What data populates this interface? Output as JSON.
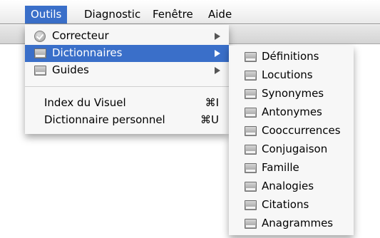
{
  "menubar": {
    "items": [
      "Outils",
      "Diagnostic",
      "Fenêtre",
      "Aide"
    ]
  },
  "outils_menu": {
    "items": [
      {
        "label": "Correcteur",
        "icon": "check-icon",
        "submenu": true
      },
      {
        "label": "Dictionnaires",
        "icon": "book-icon",
        "submenu": true
      },
      {
        "label": "Guides",
        "icon": "book-icon",
        "submenu": true
      },
      {
        "label": "Index du Visuel",
        "shortcut": "⌘I"
      },
      {
        "label": "Dictionnaire personnel",
        "shortcut": "⌘U"
      }
    ]
  },
  "dictionnaires_submenu": {
    "items": [
      "Définitions",
      "Locutions",
      "Synonymes",
      "Antonymes",
      "Cooccurrences",
      "Conjugaison",
      "Famille",
      "Analogies",
      "Citations",
      "Anagrammes"
    ]
  },
  "colors": {
    "highlight": "#3a6fc9"
  }
}
